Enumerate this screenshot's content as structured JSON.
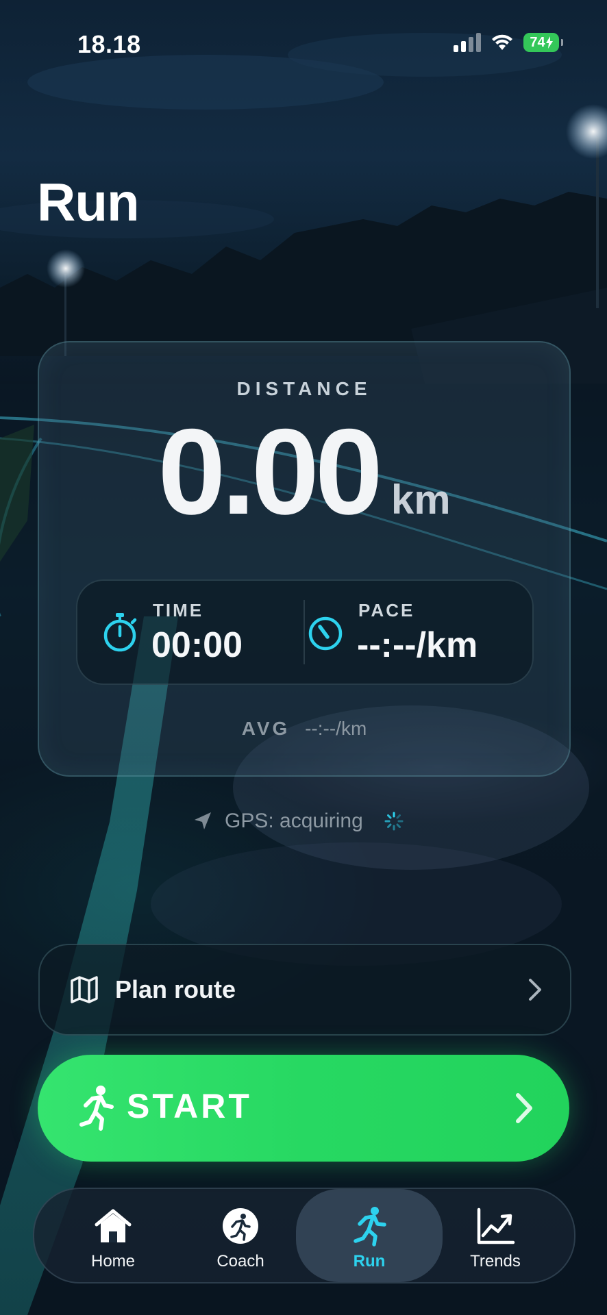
{
  "status_bar": {
    "time": "18.18",
    "battery": "74"
  },
  "page": {
    "title": "Run"
  },
  "distance": {
    "label": "DISTANCE",
    "value": "0.00",
    "unit": "km"
  },
  "metrics": {
    "time": {
      "label": "TIME",
      "value": "00:00",
      "icon": "stopwatch-icon"
    },
    "pace": {
      "label": "PACE",
      "value": "--:--/km",
      "icon": "speedometer-icon"
    }
  },
  "average": {
    "label": "AVG",
    "value": "--:--/km"
  },
  "gps": {
    "status": "GPS: acquiring"
  },
  "plan_route": {
    "label": "Plan route"
  },
  "start_button": {
    "label": "START"
  },
  "tabs": [
    {
      "label": "Home",
      "icon": "home-icon",
      "active": false
    },
    {
      "label": "Coach",
      "icon": "coach-icon",
      "active": false
    },
    {
      "label": "Run",
      "icon": "runner-icon",
      "active": true
    },
    {
      "label": "Trends",
      "icon": "trend-chart-icon",
      "active": false
    }
  ],
  "colors": {
    "accent": "#2dd2ee",
    "start_green": "#27d862",
    "battery_green": "#34c759"
  }
}
